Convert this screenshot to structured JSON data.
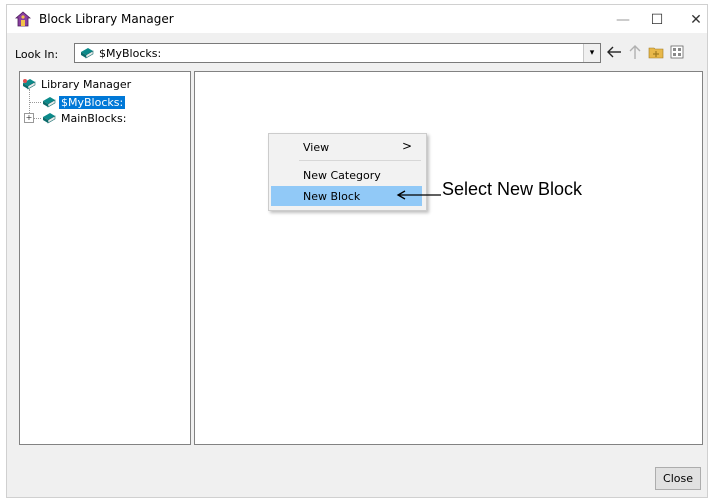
{
  "window": {
    "title": "Block Library Manager",
    "controls": {
      "minimize": "—",
      "maximize": "☐",
      "close": "✕"
    }
  },
  "toolbar": {
    "look_in_label": "Look In:",
    "look_in_value": "$MyBlocks:",
    "dropdown_arrow": "▾",
    "tools": [
      "back-arrow-icon",
      "up-arrow-icon",
      "new-folder-icon",
      "view-grid-icon"
    ]
  },
  "tree": {
    "root": {
      "label": "Library Manager",
      "icon": "library-icon"
    },
    "items": [
      {
        "label": "$MyBlocks:",
        "icon": "book-icon",
        "selected": true
      },
      {
        "label": "MainBlocks:",
        "icon": "book-icon",
        "selected": false,
        "expander": "+"
      }
    ]
  },
  "context_menu": {
    "items": [
      {
        "label": "View",
        "submenu_arrow": ">"
      },
      {
        "label": "New Category"
      },
      {
        "label": "New Block",
        "highlighted": true
      }
    ]
  },
  "annotation": {
    "text": "Select New Block"
  },
  "footer": {
    "close_label": "Close"
  },
  "colors": {
    "selection": "#0078d7",
    "menu_highlight": "#91c9f7",
    "book_icon": "#0b8a8a"
  }
}
